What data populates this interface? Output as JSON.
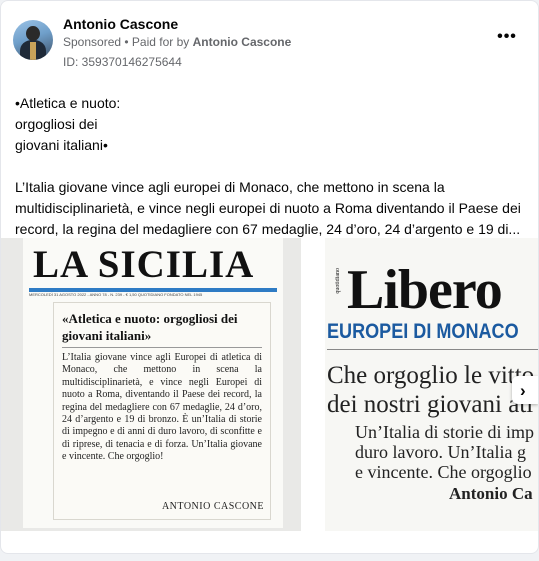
{
  "header": {
    "author": "Antonio Cascone",
    "sponsored": "Sponsored",
    "separator": " • ",
    "paid_for_prefix": "Paid for by ",
    "paid_for_name": "Antonio Cascone",
    "ad_id": "ID: 359370146275644",
    "more_icon": "more-horizontal-icon",
    "more_label": "•••"
  },
  "post": {
    "title_line_1": "•Atletica e nuoto:",
    "title_line_2": "orgogliosi dei",
    "title_line_3": "giovani italiani•",
    "body_line_1": "L’Italia giovane vince agli europei di Monaco, che mettono in scena la",
    "body_line_2": "multidisciplinarietà, e vince negli europei di nuoto a Roma diventando il Paese dei",
    "body_line_3": "record, la regina del medagliere con 67 medaglie, 24 d’oro, 24 d’argento e 19 di..."
  },
  "gallery": {
    "image_1": {
      "masthead": "LA SICILIA",
      "dateline": "MERCOLEDÌ 31 AGOSTO 2022 - ANNO 78 - N. 239 - € 1,50        QUOTIDIANO FONDATO NEL 1945",
      "clip_title": "«Atletica e nuoto: orgogliosi dei giovani italiani»",
      "clip_body": "L’Italia giovane vince agli Europei di atletica di Monaco, che mettono in scena la multidisciplinarietà, e vince negli Europei di nuoto a Roma, diventando il Paese dei record, la regina del medagliere con 67 medaglie, 24 d’oro, 24 d’argento e 19 di bronzo. È un’Italia di storie di impegno e di anni di duro lavoro, di sconfitte e di riprese, di tenacia e di forza. Un’Italia giovane e vincente. Che orgoglio!",
      "clip_signature": "ANTONIO CASCONE"
    },
    "image_2": {
      "masthead": "Libero",
      "masthead_small": "quotidiano",
      "section_head": "EUROPEI DI MONACO",
      "headline_1": "Che orgoglio le vitto",
      "headline_2": "dei nostri giovani atl",
      "text_1": "Un’Italia di storie di imp",
      "text_2": "duro lavoro. Un’Italia g",
      "text_3": "e vincente. Che orgoglio",
      "author": "Antonio Ca"
    },
    "next_icon": "chevron-right-icon",
    "next_glyph": "›"
  }
}
